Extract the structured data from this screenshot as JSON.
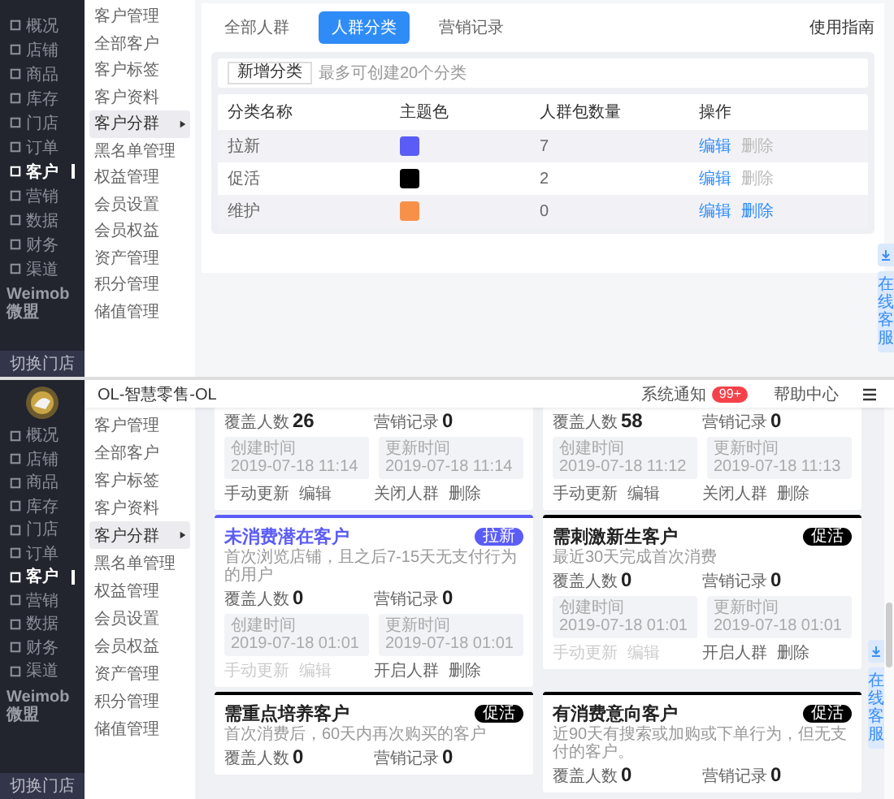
{
  "top_screen": {
    "sidebar": {
      "items": [
        {
          "label": "概况",
          "selected": false
        },
        {
          "label": "店铺",
          "selected": false
        },
        {
          "label": "商品",
          "selected": false
        },
        {
          "label": "库存",
          "selected": false
        },
        {
          "label": "门店",
          "selected": false
        },
        {
          "label": "订单",
          "selected": false
        },
        {
          "label": "客户",
          "selected": true
        },
        {
          "label": "营销",
          "selected": false
        },
        {
          "label": "数据",
          "selected": false
        },
        {
          "label": "财务",
          "selected": false
        },
        {
          "label": "渠道",
          "selected": false
        }
      ],
      "brand": "Weimob 微盟",
      "switch_store": "切换门店"
    },
    "subnav": {
      "items": [
        {
          "label": "客户管理",
          "selected": false
        },
        {
          "label": "全部客户",
          "selected": false
        },
        {
          "label": "客户标签",
          "selected": false
        },
        {
          "label": "客户资料",
          "selected": false
        },
        {
          "label": "客户分群",
          "selected": true
        },
        {
          "label": "黑名单管理",
          "selected": false
        },
        {
          "label": "权益管理",
          "selected": false
        },
        {
          "label": "会员设置",
          "selected": false
        },
        {
          "label": "会员权益",
          "selected": false
        },
        {
          "label": "资产管理",
          "selected": false
        },
        {
          "label": "积分管理",
          "selected": false
        },
        {
          "label": "储值管理",
          "selected": false
        }
      ]
    },
    "tabs": [
      {
        "label": "全部人群",
        "selected": false
      },
      {
        "label": "人群分类",
        "selected": true
      },
      {
        "label": "营销记录",
        "selected": false
      }
    ],
    "guide_link": "使用指南",
    "new_button": "新增分类",
    "hint": "最多可创建20个分类",
    "table": {
      "columns": [
        "分类名称",
        "主题色",
        "人群包数量",
        "操作"
      ],
      "rows": [
        {
          "name": "拉新",
          "color": "#5b5cf6",
          "count": "7",
          "actions": [
            {
              "label": "编辑",
              "disabled": false
            },
            {
              "label": "删除",
              "disabled": true
            }
          ]
        },
        {
          "name": "促活",
          "color": "#000000",
          "count": "2",
          "actions": [
            {
              "label": "编辑",
              "disabled": false
            },
            {
              "label": "删除",
              "disabled": true
            }
          ]
        },
        {
          "name": "维护",
          "color": "#f7914a",
          "count": "0",
          "actions": [
            {
              "label": "编辑",
              "disabled": false
            },
            {
              "label": "删除",
              "disabled": false
            }
          ]
        }
      ]
    },
    "service_button": "在线客服"
  },
  "bottom_screen": {
    "sidebar": {
      "items": [
        {
          "label": "概况",
          "selected": false
        },
        {
          "label": "店铺",
          "selected": false
        },
        {
          "label": "商品",
          "selected": false
        },
        {
          "label": "库存",
          "selected": false
        },
        {
          "label": "门店",
          "selected": false
        },
        {
          "label": "订单",
          "selected": false
        },
        {
          "label": "客户",
          "selected": true
        },
        {
          "label": "营销",
          "selected": false
        },
        {
          "label": "数据",
          "selected": false
        },
        {
          "label": "财务",
          "selected": false
        },
        {
          "label": "渠道",
          "selected": false
        }
      ],
      "brand": "Weimob 微盟",
      "switch_store": "切换门店"
    },
    "header": {
      "title": "OL-智慧零售-OL",
      "notice": "系统通知",
      "notice_badge": "99+",
      "help": "帮助中心"
    },
    "subnav": {
      "items": [
        {
          "label": "客户管理",
          "selected": false
        },
        {
          "label": "全部客户",
          "selected": false
        },
        {
          "label": "客户标签",
          "selected": false
        },
        {
          "label": "客户资料",
          "selected": false
        },
        {
          "label": "客户分群",
          "selected": true
        },
        {
          "label": "黑名单管理",
          "selected": false
        },
        {
          "label": "权益管理",
          "selected": false
        },
        {
          "label": "会员设置",
          "selected": false
        },
        {
          "label": "会员权益",
          "selected": false
        },
        {
          "label": "资产管理",
          "selected": false
        },
        {
          "label": "积分管理",
          "selected": false
        },
        {
          "label": "储值管理",
          "selected": false
        }
      ]
    },
    "cards": [
      {
        "stats": [
          {
            "label": "覆盖人数",
            "value": "26"
          },
          {
            "label": "营销记录",
            "value": "0"
          }
        ],
        "dates": [
          {
            "label": "创建时间",
            "value": "2019-07-18 11:14"
          },
          {
            "label": "更新时间",
            "value": "2019-07-18 11:14"
          }
        ],
        "actions": [
          {
            "label": "手动更新",
            "disabled": false
          },
          {
            "label": "编辑",
            "disabled": false
          },
          {
            "label": "关闭人群",
            "disabled": false
          },
          {
            "label": "删除",
            "disabled": false
          }
        ]
      },
      {
        "stats": [
          {
            "label": "覆盖人数",
            "value": "58"
          },
          {
            "label": "营销记录",
            "value": "0"
          }
        ],
        "dates": [
          {
            "label": "创建时间",
            "value": "2019-07-18 11:12"
          },
          {
            "label": "更新时间",
            "value": "2019-07-18 11:13"
          }
        ],
        "actions": [
          {
            "label": "手动更新",
            "disabled": false
          },
          {
            "label": "编辑",
            "disabled": false
          },
          {
            "label": "关闭人群",
            "disabled": false
          },
          {
            "label": "删除",
            "disabled": false
          }
        ]
      },
      {
        "title": "未消费潜在客户",
        "badge": "拉新",
        "color": "#5b5cf6",
        "selected": true,
        "description": "首次浏览店铺，且之后7-15天无支付行为的用户",
        "stats": [
          {
            "label": "覆盖人数",
            "value": "0"
          },
          {
            "label": "营销记录",
            "value": "0"
          }
        ],
        "dates": [
          {
            "label": "创建时间",
            "value": "2019-07-18 01:01"
          },
          {
            "label": "更新时间",
            "value": "2019-07-18 01:01"
          }
        ],
        "actions": [
          {
            "label": "手动更新",
            "disabled": true
          },
          {
            "label": "编辑",
            "disabled": true
          },
          {
            "label": "开启人群",
            "disabled": false
          },
          {
            "label": "删除",
            "disabled": false
          }
        ]
      },
      {
        "title": "需刺激新生客户",
        "badge": "促活",
        "color": "#000000",
        "selected": false,
        "description": "最近30天完成首次消费",
        "stats": [
          {
            "label": "覆盖人数",
            "value": "0"
          },
          {
            "label": "营销记录",
            "value": "0"
          }
        ],
        "dates": [
          {
            "label": "创建时间",
            "value": "2019-07-18 01:01"
          },
          {
            "label": "更新时间",
            "value": "2019-07-18 01:01"
          }
        ],
        "actions": [
          {
            "label": "手动更新",
            "disabled": true
          },
          {
            "label": "编辑",
            "disabled": true
          },
          {
            "label": "开启人群",
            "disabled": false
          },
          {
            "label": "删除",
            "disabled": false
          }
        ]
      },
      {
        "title": "需重点培养客户",
        "badge": "促活",
        "color": "#000000",
        "selected": false,
        "description": "首次消费后，60天内再次购买的客户",
        "stats": [
          {
            "label": "覆盖人数",
            "value": "0"
          },
          {
            "label": "营销记录",
            "value": "0"
          }
        ]
      },
      {
        "title": "有消费意向客户",
        "badge": "促活",
        "color": "#000000",
        "selected": false,
        "description": "近90天有搜索或加购或下单行为，但无支付的客户。",
        "stats": [
          {
            "label": "覆盖人数",
            "value": "0"
          },
          {
            "label": "营销记录",
            "value": "0"
          }
        ]
      }
    ],
    "service_button": "在线客服"
  }
}
